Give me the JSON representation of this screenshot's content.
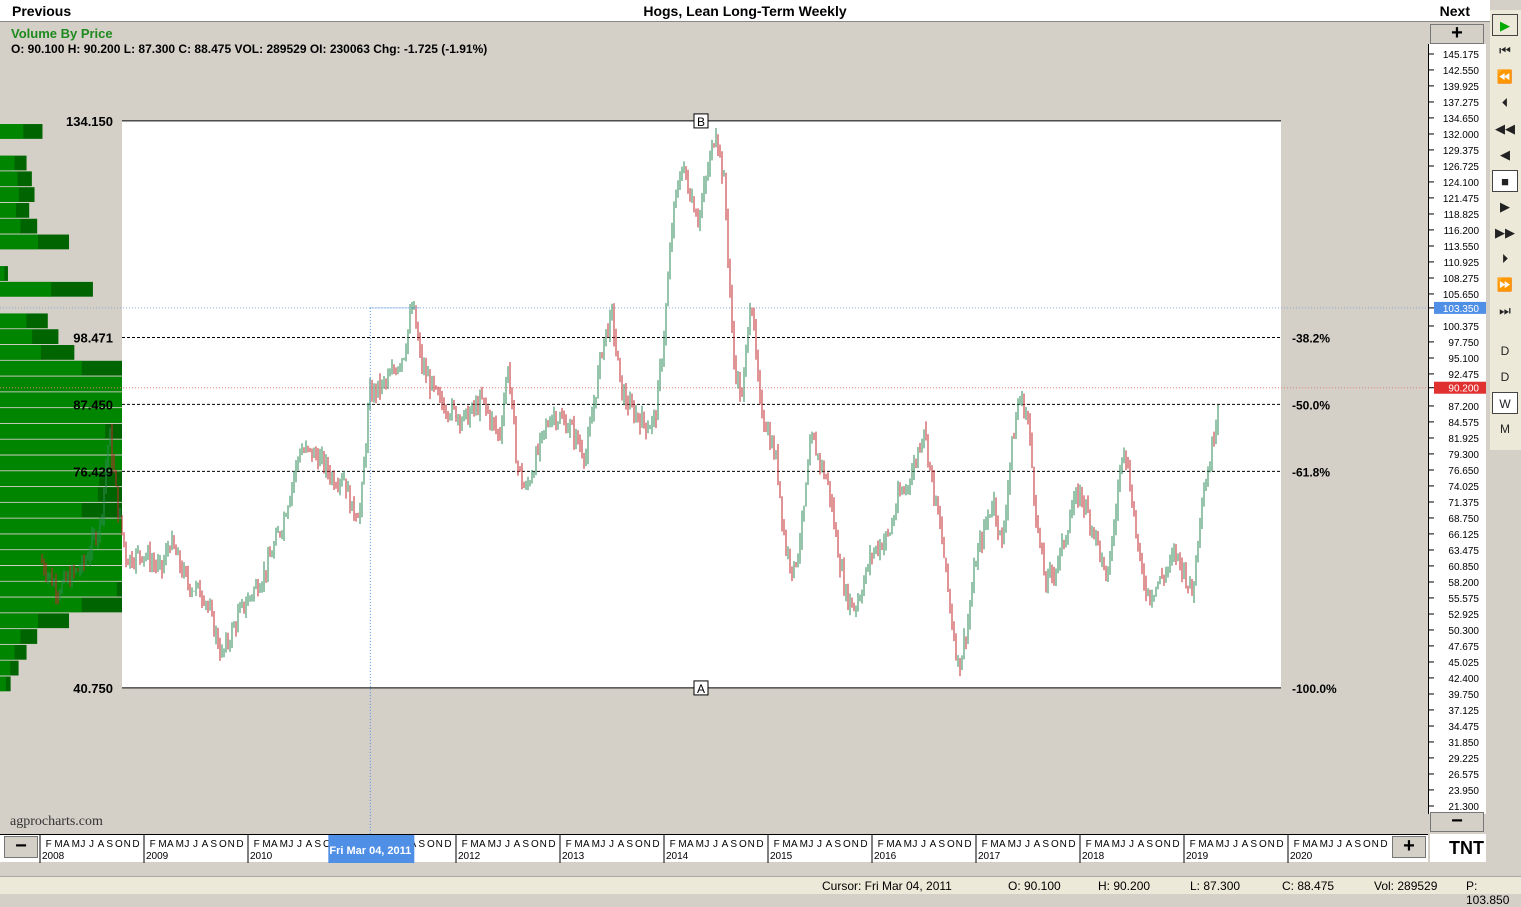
{
  "header": {
    "prev_label": "Previous",
    "title": "Hogs, Lean Long-Term Weekly",
    "next_label": "Next"
  },
  "indicator_label": "Volume By Price",
  "ohlc_summary": "O: 90.100  H: 90.200  L: 87.300  C: 88.475  VOL: 289529  OI: 230063  Chg: -1.725 (-1.91%)",
  "watermark": "agprocharts.com",
  "colors": {
    "up_bar": "#2e8b57",
    "down_bar": "#c0282e",
    "volume_dark": "#006400",
    "volume_bright": "#00a000",
    "cursor_highlight": "#4f8fe6",
    "price_highlight": "#e03030"
  },
  "sidebar": {
    "items": [
      {
        "name": "play-icon",
        "glyph": "▶"
      },
      {
        "name": "first-icon",
        "glyph": "⏮"
      },
      {
        "name": "fast-back-icon",
        "glyph": "⏪"
      },
      {
        "name": "step-back-icon",
        "glyph": "⏴"
      },
      {
        "name": "rewind-icon",
        "glyph": "◀◀"
      },
      {
        "name": "back-icon",
        "glyph": "◀"
      },
      {
        "name": "stop-icon",
        "glyph": "■"
      },
      {
        "name": "forward-icon",
        "glyph": "▶"
      },
      {
        "name": "fast-forward-icon",
        "glyph": "▶▶"
      },
      {
        "name": "step-forward-icon",
        "glyph": "⏵"
      },
      {
        "name": "skip-forward-icon",
        "glyph": "⏩"
      },
      {
        "name": "last-icon",
        "glyph": "⏭"
      }
    ],
    "periods": [
      "D",
      "D",
      "W",
      "M"
    ]
  },
  "xaxis_minus": "−",
  "xaxis_plus": "+",
  "yaxis_plus": "+",
  "yaxis_minus": "−",
  "logo": "TNT",
  "statusbar": {
    "cursor": "Cursor: Fri Mar 04, 2011",
    "open": "O: 90.100",
    "high": "H: 90.200",
    "low": "L: 87.300",
    "close": "C: 88.475",
    "vol": "Vol: 289529",
    "price": "P: 103.850"
  },
  "chart_data": {
    "type": "ohlc",
    "title": "Hogs, Lean Long-Term Weekly",
    "y_range": [
      21.3,
      145.175
    ],
    "y_ticks": [
      "145.175",
      "142.550",
      "139.925",
      "137.275",
      "134.650",
      "132.000",
      "129.375",
      "126.725",
      "124.100",
      "121.475",
      "118.825",
      "116.200",
      "113.550",
      "110.925",
      "108.275",
      "105.650",
      "103.350",
      "100.375",
      "97.750",
      "95.100",
      "92.475",
      "90.200",
      "87.200",
      "84.575",
      "81.925",
      "79.300",
      "76.650",
      "74.025",
      "71.375",
      "68.750",
      "66.125",
      "63.475",
      "60.850",
      "58.200",
      "55.575",
      "52.925",
      "50.300",
      "47.675",
      "45.025",
      "42.400",
      "39.750",
      "37.125",
      "34.475",
      "31.850",
      "29.225",
      "26.575",
      "23.950",
      "21.300"
    ],
    "highlight_ticks": {
      "cursor_price": "103.350",
      "last_price": "90.200"
    },
    "x_years": [
      "2008",
      "2009",
      "2010",
      "2011",
      "2012",
      "2013",
      "2014",
      "2015",
      "2016",
      "2017",
      "2018",
      "2019",
      "2020"
    ],
    "x_month_letters": "FMAMJJASOND",
    "cursor_date_label": "Fri Mar 04, 2011",
    "retracement": {
      "high_label": "134.150",
      "low_label": "40.750",
      "levels": [
        {
          "price": 98.471,
          "label": "98.471",
          "pct": "-38.2%"
        },
        {
          "price": 87.45,
          "label": "87.450",
          "pct": "-50.0%"
        },
        {
          "price": 76.429,
          "label": "76.429",
          "pct": "-61.8%"
        },
        {
          "price": 40.75,
          "label": "40.750",
          "pct": "-100.0%"
        }
      ],
      "point_a": "A",
      "point_b": "B"
    },
    "price_anchors": [
      [
        "2008-01",
        62
      ],
      [
        "2008-03",
        57
      ],
      [
        "2008-06",
        61
      ],
      [
        "2008-08",
        68
      ],
      [
        "2008-09",
        83
      ],
      [
        "2008-10",
        70
      ],
      [
        "2008-11",
        62
      ],
      [
        "2009-01",
        63
      ],
      [
        "2009-03",
        60
      ],
      [
        "2009-04",
        65
      ],
      [
        "2009-06",
        58
      ],
      [
        "2009-08",
        56
      ],
      [
        "2009-10",
        46
      ],
      [
        "2009-12",
        53
      ],
      [
        "2010-03",
        60
      ],
      [
        "2010-05",
        68
      ],
      [
        "2010-07",
        80
      ],
      [
        "2010-09",
        79
      ],
      [
        "2010-11",
        75
      ],
      [
        "2010-12",
        76
      ],
      [
        "2011-01",
        70
      ],
      [
        "2011-02",
        70
      ],
      [
        "2011-03",
        89
      ],
      [
        "2011-05",
        91
      ],
      [
        "2011-07",
        96
      ],
      [
        "2011-08",
        104
      ],
      [
        "2011-09",
        94
      ],
      [
        "2011-11",
        88
      ],
      [
        "2011-12",
        87
      ],
      [
        "2012-02",
        85
      ],
      [
        "2012-04",
        88
      ],
      [
        "2012-06",
        82
      ],
      [
        "2012-07",
        94
      ],
      [
        "2012-08",
        78
      ],
      [
        "2012-09",
        73
      ],
      [
        "2012-11",
        82
      ],
      [
        "2012-12",
        86
      ],
      [
        "2013-02",
        84
      ],
      [
        "2013-04",
        79
      ],
      [
        "2013-06",
        98
      ],
      [
        "2013-07",
        102
      ],
      [
        "2013-08",
        90
      ],
      [
        "2013-09",
        87
      ],
      [
        "2013-11",
        84
      ],
      [
        "2013-12",
        85
      ],
      [
        "2014-01",
        99
      ],
      [
        "2014-02",
        118
      ],
      [
        "2014-03",
        127
      ],
      [
        "2014-05",
        118
      ],
      [
        "2014-07",
        133
      ],
      [
        "2014-08",
        123
      ],
      [
        "2014-09",
        95
      ],
      [
        "2014-10",
        88
      ],
      [
        "2014-11",
        106
      ],
      [
        "2014-12",
        88
      ],
      [
        "2015-01",
        83
      ],
      [
        "2015-02",
        78
      ],
      [
        "2015-03",
        64
      ],
      [
        "2015-04",
        60
      ],
      [
        "2015-05",
        68
      ],
      [
        "2015-06",
        82
      ],
      [
        "2015-07",
        78
      ],
      [
        "2015-08",
        74
      ],
      [
        "2015-09",
        64
      ],
      [
        "2015-10",
        56
      ],
      [
        "2015-11",
        54
      ],
      [
        "2015-12",
        58
      ],
      [
        "2016-01",
        63
      ],
      [
        "2016-03",
        66
      ],
      [
        "2016-04",
        72
      ],
      [
        "2016-05",
        74
      ],
      [
        "2016-06",
        78
      ],
      [
        "2016-07",
        84
      ],
      [
        "2016-08",
        74
      ],
      [
        "2016-09",
        66
      ],
      [
        "2016-10",
        54
      ],
      [
        "2016-11",
        44
      ],
      [
        "2016-12",
        51
      ],
      [
        "2017-01",
        62
      ],
      [
        "2017-02",
        67
      ],
      [
        "2017-03",
        72
      ],
      [
        "2017-04",
        64
      ],
      [
        "2017-05",
        79
      ],
      [
        "2017-06",
        89
      ],
      [
        "2017-07",
        85
      ],
      [
        "2017-08",
        68
      ],
      [
        "2017-09",
        58
      ],
      [
        "2017-10",
        60
      ],
      [
        "2017-11",
        64
      ],
      [
        "2017-12",
        70
      ],
      [
        "2018-01",
        73
      ],
      [
        "2018-02",
        69
      ],
      [
        "2018-03",
        65
      ],
      [
        "2018-04",
        58
      ],
      [
        "2018-05",
        68
      ],
      [
        "2018-06",
        82
      ],
      [
        "2018-07",
        72
      ],
      [
        "2018-08",
        60
      ],
      [
        "2018-09",
        56
      ],
      [
        "2018-10",
        58
      ],
      [
        "2018-11",
        60
      ],
      [
        "2018-12",
        63
      ],
      [
        "2019-01",
        60
      ],
      [
        "2019-02",
        56
      ],
      [
        "2019-03",
        72
      ],
      [
        "2019-04",
        78
      ],
      [
        "2019-05",
        88.475
      ]
    ],
    "volume_by_price": [
      {
        "price": 132.5,
        "volume": 0.16
      },
      {
        "price": 127.3,
        "volume": 0.1
      },
      {
        "price": 124.7,
        "volume": 0.12
      },
      {
        "price": 122.1,
        "volume": 0.13
      },
      {
        "price": 119.5,
        "volume": 0.11
      },
      {
        "price": 116.9,
        "volume": 0.14
      },
      {
        "price": 114.3,
        "volume": 0.26
      },
      {
        "price": 109.1,
        "volume": 0.03
      },
      {
        "price": 106.5,
        "volume": 0.35
      },
      {
        "price": 101.3,
        "volume": 0.18
      },
      {
        "price": 98.7,
        "volume": 0.22
      },
      {
        "price": 96.1,
        "volume": 0.28
      },
      {
        "price": 93.5,
        "volume": 0.56
      },
      {
        "price": 90.9,
        "volume": 0.96
      },
      {
        "price": 88.3,
        "volume": 0.9
      },
      {
        "price": 85.7,
        "volume": 1.0
      },
      {
        "price": 83.1,
        "volume": 0.72
      },
      {
        "price": 80.5,
        "volume": 0.97
      },
      {
        "price": 77.9,
        "volume": 0.84
      },
      {
        "price": 75.3,
        "volume": 0.68
      },
      {
        "price": 72.7,
        "volume": 0.67
      },
      {
        "price": 70.1,
        "volume": 0.56
      },
      {
        "price": 67.5,
        "volume": 1.13
      },
      {
        "price": 64.9,
        "volume": 1.0
      },
      {
        "price": 62.3,
        "volume": 0.84
      },
      {
        "price": 59.7,
        "volume": 0.96
      },
      {
        "price": 57.1,
        "volume": 0.8
      },
      {
        "price": 54.5,
        "volume": 0.56
      },
      {
        "price": 51.9,
        "volume": 0.26
      },
      {
        "price": 49.3,
        "volume": 0.14
      },
      {
        "price": 46.7,
        "volume": 0.1
      },
      {
        "price": 44.1,
        "volume": 0.07
      },
      {
        "price": 41.5,
        "volume": 0.04
      }
    ]
  }
}
